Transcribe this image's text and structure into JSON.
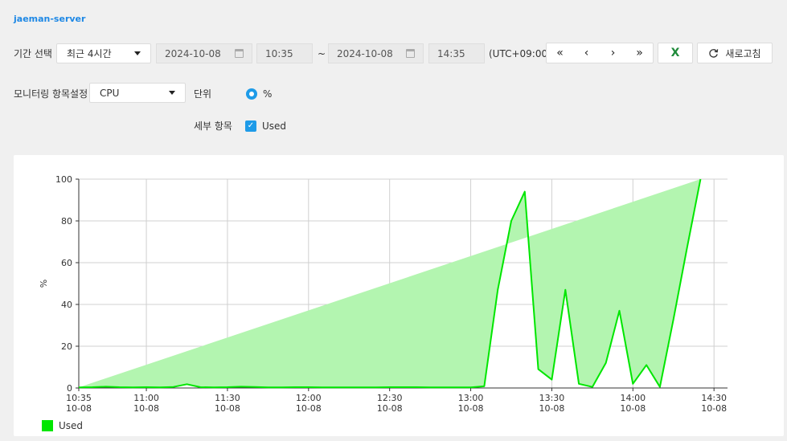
{
  "server": {
    "name": "jaeman-server"
  },
  "period": {
    "label": "기간 선택",
    "preset": "최근 4시간",
    "start_date": "2024-10-08",
    "start_time": "10:35",
    "separator": "~",
    "end_date": "2024-10-08",
    "end_time": "14:35",
    "timezone": "(UTC+09:00)"
  },
  "nav": {
    "first": "«",
    "prev": "‹",
    "next": "›",
    "last": "»"
  },
  "toolbar": {
    "excel_label": "X",
    "refresh_label": "새로고침",
    "refresh_icon": "refresh-icon"
  },
  "monitor": {
    "label": "모니터링 항목설정",
    "item": "CPU",
    "unit_label": "단위",
    "unit_value": "%",
    "detail_label": "세부 항목",
    "detail_value": "Used"
  },
  "colors": {
    "accent": "#1e9be8",
    "series": "#00e600",
    "fill": "#b3f5b0",
    "title": "#1e88e5"
  },
  "chart_data": {
    "type": "area",
    "ylabel": "%",
    "ylim": [
      0,
      100
    ],
    "yticks": [
      0,
      20,
      40,
      60,
      80,
      100
    ],
    "x_ticks": [
      {
        "time": "10:35",
        "date": "10-08",
        "min": 0
      },
      {
        "time": "11:00",
        "date": "10-08",
        "min": 25
      },
      {
        "time": "11:30",
        "date": "10-08",
        "min": 55
      },
      {
        "time": "12:00",
        "date": "10-08",
        "min": 85
      },
      {
        "time": "12:30",
        "date": "10-08",
        "min": 115
      },
      {
        "time": "13:00",
        "date": "10-08",
        "min": 145
      },
      {
        "time": "13:30",
        "date": "10-08",
        "min": 175
      },
      {
        "time": "14:00",
        "date": "10-08",
        "min": 205
      },
      {
        "time": "14:30",
        "date": "10-08",
        "min": 235
      }
    ],
    "xlim_min": [
      0,
      240
    ],
    "grid": true,
    "legend": "bottom-left",
    "series": [
      {
        "name": "Used",
        "x_min": [
          0,
          5,
          10,
          15,
          20,
          25,
          30,
          35,
          40,
          45,
          50,
          55,
          60,
          65,
          70,
          75,
          80,
          85,
          90,
          95,
          100,
          105,
          110,
          115,
          120,
          125,
          130,
          135,
          140,
          145,
          150,
          155,
          160,
          165,
          170,
          175,
          180,
          185,
          190,
          195,
          200,
          205,
          210,
          215,
          220,
          225,
          230,
          235
        ],
        "values": [
          0.3,
          0.4,
          0.6,
          0.4,
          0.3,
          0.4,
          0.3,
          0.5,
          1.8,
          0.4,
          0.3,
          0.4,
          0.6,
          0.5,
          0.3,
          0.3,
          0.4,
          0.4,
          0.3,
          0.3,
          0.3,
          0.3,
          0.3,
          0.4,
          0.4,
          0.4,
          0.3,
          0.3,
          0.3,
          0.3,
          0.8,
          47,
          80,
          94,
          9,
          4,
          47,
          2,
          0.5,
          12,
          37,
          2,
          11,
          0.5,
          33,
          67,
          100
        ]
      }
    ]
  }
}
